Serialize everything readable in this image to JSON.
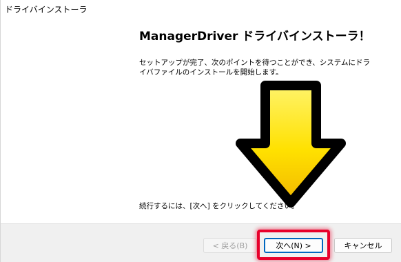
{
  "window": {
    "title": "ドライバインストーラ"
  },
  "main": {
    "heading": "ManagerDriver ドライバインストーラ！",
    "intro": "セットアップが完了、次のポイントを待つことができ、システムにドライバファイルのインストールを開始します。",
    "continue_text": "続行するには、[次へ] をクリックしてください。"
  },
  "annotation": {
    "arrow_icon": "down-arrow-icon",
    "arrow_color": "#ffd400",
    "highlight_color": "#e8002b"
  },
  "footer": {
    "back_label": "< 戻る(B)",
    "next_label": "次へ(N) >",
    "cancel_label": "キャンセル"
  }
}
